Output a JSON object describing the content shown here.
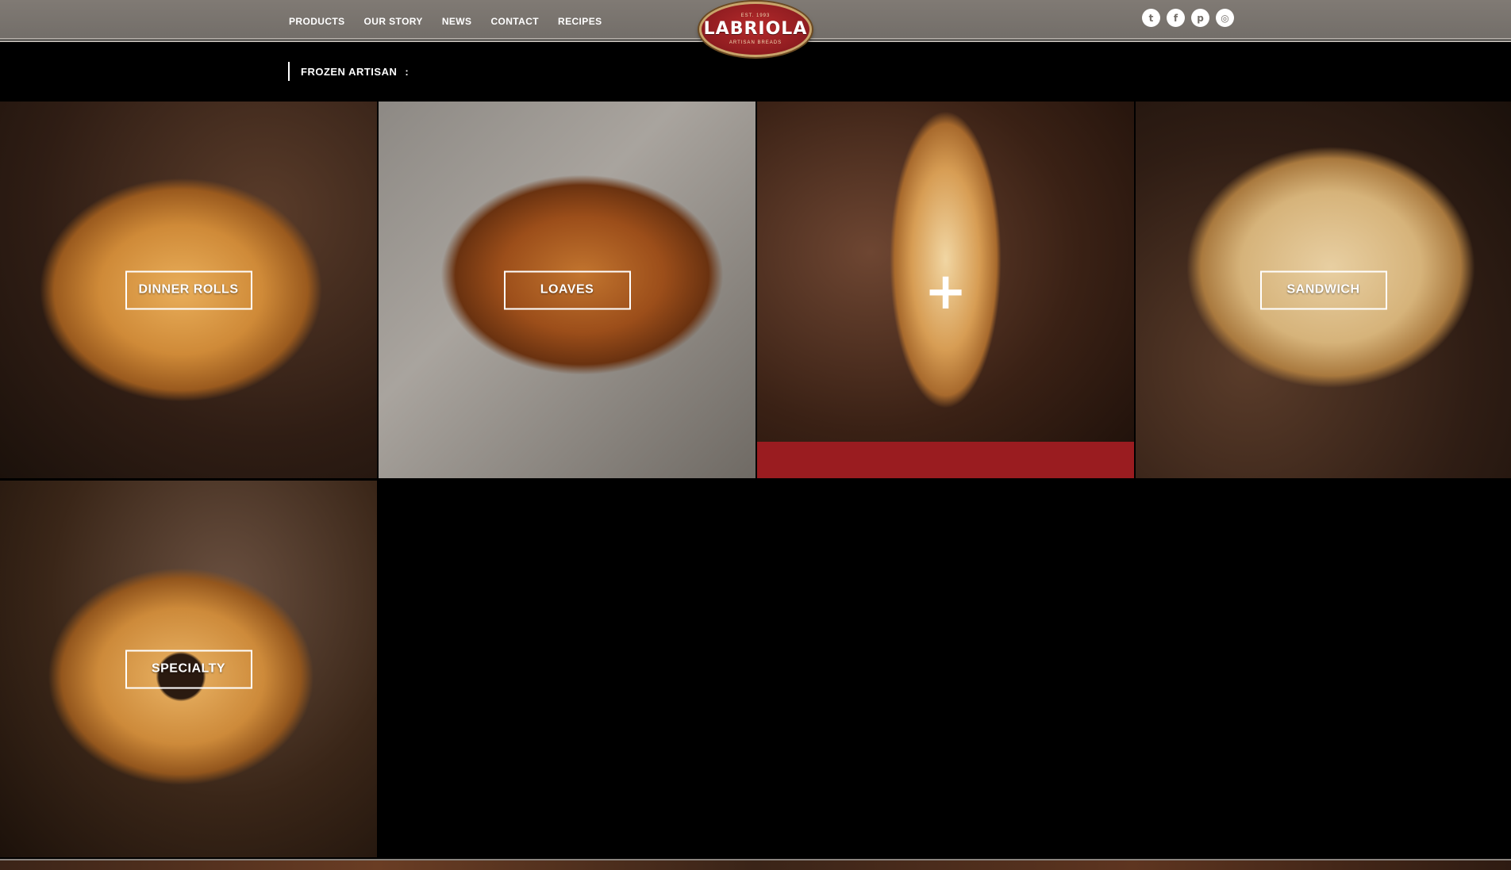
{
  "header": {
    "nav": [
      "PRODUCTS",
      "OUR STORY",
      "NEWS",
      "CONTACT",
      "RECIPES"
    ],
    "logo": {
      "est": "EST. 1993",
      "name": "LABRIOLA",
      "tagline": "ARTISAN BREADS"
    },
    "social": [
      {
        "icon": "twitter-icon",
        "glyph": "t"
      },
      {
        "icon": "facebook-icon",
        "glyph": "f"
      },
      {
        "icon": "pinterest-icon",
        "glyph": "p"
      },
      {
        "icon": "instagram-icon",
        "glyph": "◎"
      }
    ]
  },
  "breadcrumb": {
    "label": "FROZEN ARTISAN",
    "separator": ":"
  },
  "tiles": [
    {
      "label": "DINNER ROLLS"
    },
    {
      "label": "LOAVES"
    },
    {
      "label": "",
      "glyph": "+"
    },
    {
      "label": "SANDWICH"
    },
    {
      "label": "SPECIALTY"
    }
  ],
  "colors": {
    "header": "#7a746f",
    "accent_red": "#9a1c20",
    "logo_red": "#a52226"
  }
}
